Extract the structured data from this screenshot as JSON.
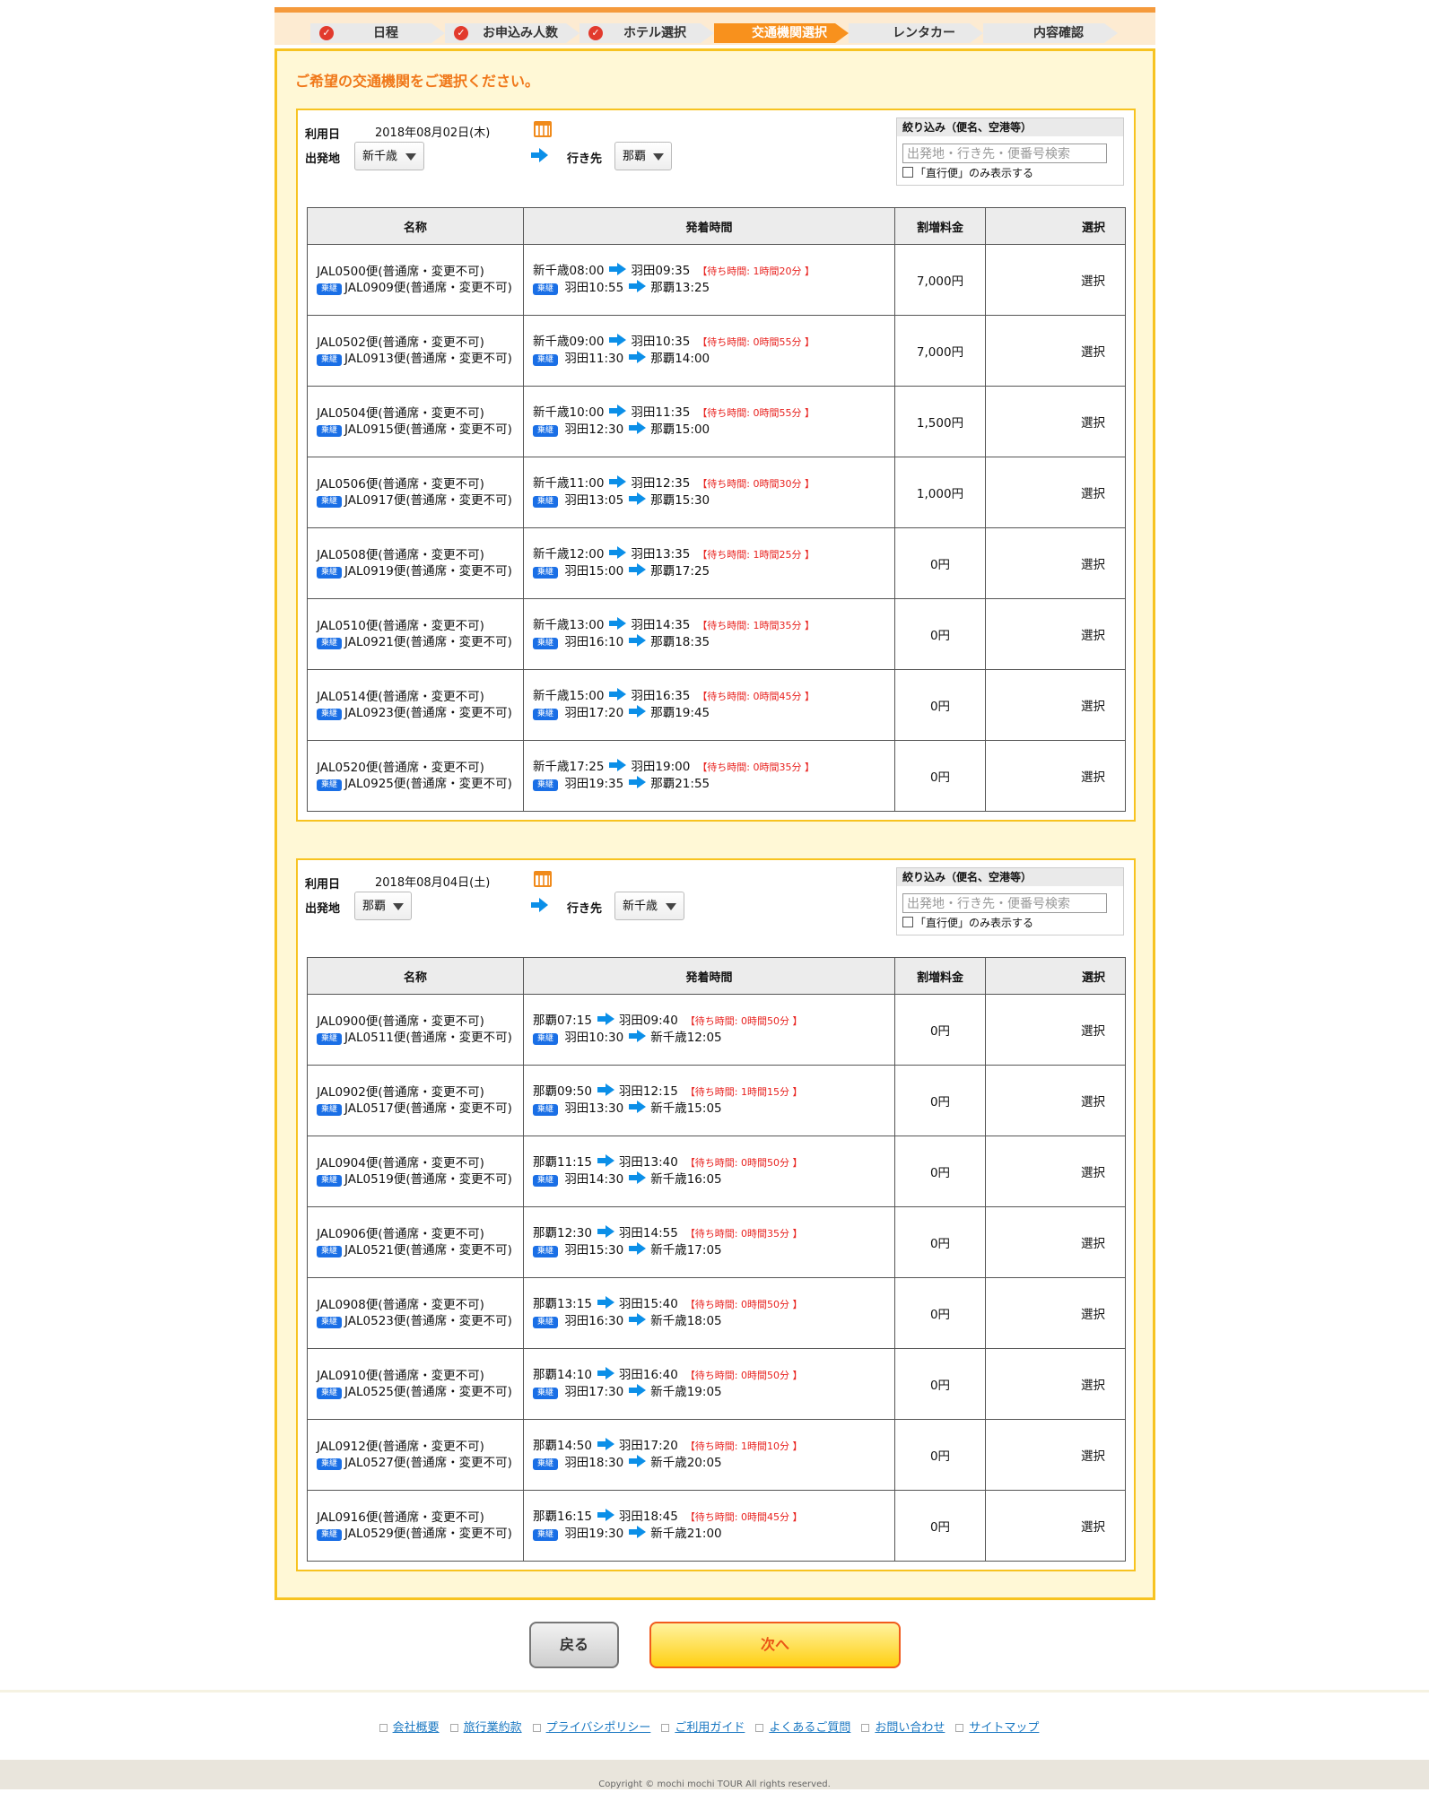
{
  "steps": [
    {
      "label": "日程",
      "done": true
    },
    {
      "label": "お申込み人数",
      "done": true
    },
    {
      "label": "ホテル選択",
      "done": true
    },
    {
      "label": "交通機関選択",
      "current": true
    },
    {
      "label": "レンタカー"
    },
    {
      "label": "内容確認"
    }
  ],
  "heading": "ご希望の交通機関をご選択ください。",
  "labels": {
    "date": "利用日",
    "origin": "出発地",
    "dest": "行き先",
    "filter_title": "絞り込み（便名、空港等）",
    "filter_placeholder": "出発地・行き先・便番号検索",
    "direct_only": "「直行便」のみ表示する",
    "col_name": "名称",
    "col_time": "発着時間",
    "col_fee": "割増料金",
    "col_select": "選択",
    "transfer_tag": "乗継",
    "select": "選択"
  },
  "legs": [
    {
      "date": "2018年08月02日(木)",
      "origin": "新千歳",
      "dest": "那覇",
      "flights": [
        {
          "name1": "JAL0500便(普通席・変更不可)",
          "name2": "JAL0909便(普通席・変更不可)",
          "l1_from": "新千歳08:00",
          "l1_to": "羽田09:35",
          "wait": "【待ち時間: 1時間20分 】",
          "l2_from": "羽田10:55",
          "l2_to": "那覇13:25",
          "fee": "7,000円"
        },
        {
          "name1": "JAL0502便(普通席・変更不可)",
          "name2": "JAL0913便(普通席・変更不可)",
          "l1_from": "新千歳09:00",
          "l1_to": "羽田10:35",
          "wait": "【待ち時間: 0時間55分 】",
          "l2_from": "羽田11:30",
          "l2_to": "那覇14:00",
          "fee": "7,000円"
        },
        {
          "name1": "JAL0504便(普通席・変更不可)",
          "name2": "JAL0915便(普通席・変更不可)",
          "l1_from": "新千歳10:00",
          "l1_to": "羽田11:35",
          "wait": "【待ち時間: 0時間55分 】",
          "l2_from": "羽田12:30",
          "l2_to": "那覇15:00",
          "fee": "1,500円"
        },
        {
          "name1": "JAL0506便(普通席・変更不可)",
          "name2": "JAL0917便(普通席・変更不可)",
          "l1_from": "新千歳11:00",
          "l1_to": "羽田12:35",
          "wait": "【待ち時間: 0時間30分 】",
          "l2_from": "羽田13:05",
          "l2_to": "那覇15:30",
          "fee": "1,000円"
        },
        {
          "name1": "JAL0508便(普通席・変更不可)",
          "name2": "JAL0919便(普通席・変更不可)",
          "l1_from": "新千歳12:00",
          "l1_to": "羽田13:35",
          "wait": "【待ち時間: 1時間25分 】",
          "l2_from": "羽田15:00",
          "l2_to": "那覇17:25",
          "fee": "0円"
        },
        {
          "name1": "JAL0510便(普通席・変更不可)",
          "name2": "JAL0921便(普通席・変更不可)",
          "l1_from": "新千歳13:00",
          "l1_to": "羽田14:35",
          "wait": "【待ち時間: 1時間35分 】",
          "l2_from": "羽田16:10",
          "l2_to": "那覇18:35",
          "fee": "0円"
        },
        {
          "name1": "JAL0514便(普通席・変更不可)",
          "name2": "JAL0923便(普通席・変更不可)",
          "l1_from": "新千歳15:00",
          "l1_to": "羽田16:35",
          "wait": "【待ち時間: 0時間45分 】",
          "l2_from": "羽田17:20",
          "l2_to": "那覇19:45",
          "fee": "0円"
        },
        {
          "name1": "JAL0520便(普通席・変更不可)",
          "name2": "JAL0925便(普通席・変更不可)",
          "l1_from": "新千歳17:25",
          "l1_to": "羽田19:00",
          "wait": "【待ち時間: 0時間35分 】",
          "l2_from": "羽田19:35",
          "l2_to": "那覇21:55",
          "fee": "0円"
        }
      ]
    },
    {
      "date": "2018年08月04日(土)",
      "origin": "那覇",
      "dest": "新千歳",
      "flights": [
        {
          "name1": "JAL0900便(普通席・変更不可)",
          "name2": "JAL0511便(普通席・変更不可)",
          "l1_from": "那覇07:15",
          "l1_to": "羽田09:40",
          "wait": "【待ち時間: 0時間50分 】",
          "l2_from": "羽田10:30",
          "l2_to": "新千歳12:05",
          "fee": "0円"
        },
        {
          "name1": "JAL0902便(普通席・変更不可)",
          "name2": "JAL0517便(普通席・変更不可)",
          "l1_from": "那覇09:50",
          "l1_to": "羽田12:15",
          "wait": "【待ち時間: 1時間15分 】",
          "l2_from": "羽田13:30",
          "l2_to": "新千歳15:05",
          "fee": "0円"
        },
        {
          "name1": "JAL0904便(普通席・変更不可)",
          "name2": "JAL0519便(普通席・変更不可)",
          "l1_from": "那覇11:15",
          "l1_to": "羽田13:40",
          "wait": "【待ち時間: 0時間50分 】",
          "l2_from": "羽田14:30",
          "l2_to": "新千歳16:05",
          "fee": "0円"
        },
        {
          "name1": "JAL0906便(普通席・変更不可)",
          "name2": "JAL0521便(普通席・変更不可)",
          "l1_from": "那覇12:30",
          "l1_to": "羽田14:55",
          "wait": "【待ち時間: 0時間35分 】",
          "l2_from": "羽田15:30",
          "l2_to": "新千歳17:05",
          "fee": "0円"
        },
        {
          "name1": "JAL0908便(普通席・変更不可)",
          "name2": "JAL0523便(普通席・変更不可)",
          "l1_from": "那覇13:15",
          "l1_to": "羽田15:40",
          "wait": "【待ち時間: 0時間50分 】",
          "l2_from": "羽田16:30",
          "l2_to": "新千歳18:05",
          "fee": "0円"
        },
        {
          "name1": "JAL0910便(普通席・変更不可)",
          "name2": "JAL0525便(普通席・変更不可)",
          "l1_from": "那覇14:10",
          "l1_to": "羽田16:40",
          "wait": "【待ち時間: 0時間50分 】",
          "l2_from": "羽田17:30",
          "l2_to": "新千歳19:05",
          "fee": "0円"
        },
        {
          "name1": "JAL0912便(普通席・変更不可)",
          "name2": "JAL0527便(普通席・変更不可)",
          "l1_from": "那覇14:50",
          "l1_to": "羽田17:20",
          "wait": "【待ち時間: 1時間10分 】",
          "l2_from": "羽田18:30",
          "l2_to": "新千歳20:05",
          "fee": "0円"
        },
        {
          "name1": "JAL0916便(普通席・変更不可)",
          "name2": "JAL0529便(普通席・変更不可)",
          "l1_from": "那覇16:15",
          "l1_to": "羽田18:45",
          "wait": "【待ち時間: 0時間45分 】",
          "l2_from": "羽田19:30",
          "l2_to": "新千歳21:00",
          "fee": "0円"
        }
      ]
    }
  ],
  "buttons": {
    "back": "戻る",
    "next": "次へ"
  },
  "footer": {
    "links": [
      "会社概要",
      "旅行業約款",
      "プライバシポリシー",
      "ご利用ガイド",
      "よくあるご質問",
      "お問い合わせ",
      "サイトマップ"
    ],
    "copyright": "Copyright © mochi mochi TOUR  All rights reserved."
  },
  "colors": {
    "accent_orange": "#f8911d",
    "panel_border": "#f7c321",
    "panel_bg": "#fff8d6",
    "wait_red": "#e8221f",
    "arrow_blue": "#0b8fe8",
    "tag_blue": "#1a6fe6"
  },
  "icons": [
    "check-icon",
    "calendar-icon",
    "arrow-right-icon",
    "dropdown-triangle-icon",
    "checkbox-icon",
    "footer-bullet-icon"
  ]
}
